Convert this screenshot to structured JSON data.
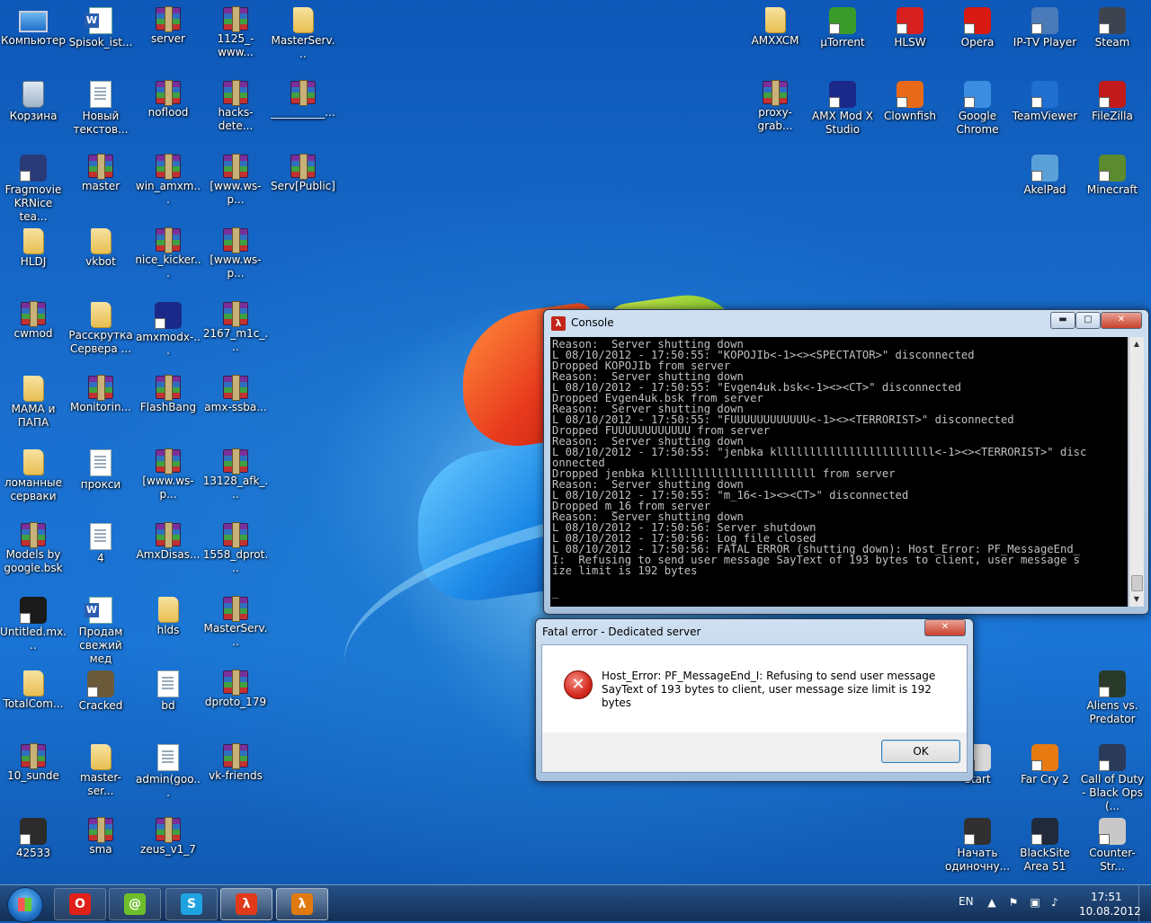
{
  "desktop": {
    "icons_left": [
      {
        "label": "Компьютер",
        "icon": "computer-icon"
      },
      {
        "label": "Spisok_ist...",
        "icon": "word-doc-icon"
      },
      {
        "label": "server",
        "icon": "winrar-icon"
      },
      {
        "label": "1125_-www...",
        "icon": "winrar-icon"
      },
      {
        "label": "MasterServ...",
        "icon": "folder-icon"
      },
      {
        "label": "Корзина",
        "icon": "recycle-bin-icon"
      },
      {
        "label": "Новый текстов...",
        "icon": "text-doc-icon"
      },
      {
        "label": "noflood",
        "icon": "winrar-icon"
      },
      {
        "label": "hacks-dete...",
        "icon": "winrar-icon"
      },
      {
        "label": "__________...",
        "icon": "winrar-icon"
      },
      {
        "label": "Fragmovie KRNice tea...",
        "icon": "flv-icon"
      },
      {
        "label": "master",
        "icon": "winrar-icon"
      },
      {
        "label": "win_amxm...",
        "icon": "winrar-icon"
      },
      {
        "label": "[www.ws-p...",
        "icon": "winrar-icon"
      },
      {
        "label": "Serv[Public]",
        "icon": "winrar-icon"
      },
      {
        "label": "HLDJ",
        "icon": "folder-icon"
      },
      {
        "label": "vkbot",
        "icon": "folder-icon"
      },
      {
        "label": "nice_kicker...",
        "icon": "winrar-icon"
      },
      {
        "label": "[www.ws-p...",
        "icon": "winrar-icon"
      },
      {
        "label": "cwmod",
        "icon": "winrar-icon"
      },
      {
        "label": "Расскрутка Сервера ...",
        "icon": "folder-icon"
      },
      {
        "label": "amxmodx-...",
        "icon": "amxx-icon"
      },
      {
        "label": "2167_m1c_...",
        "icon": "winrar-icon"
      },
      {
        "label": "МАМА и ПАПА",
        "icon": "folder-icon"
      },
      {
        "label": "Monitorin...",
        "icon": "winrar-icon"
      },
      {
        "label": "FlashBang",
        "icon": "winrar-icon"
      },
      {
        "label": "amx-ssba...",
        "icon": "winrar-icon"
      },
      {
        "label": "ломанные серваки",
        "icon": "folder-icon"
      },
      {
        "label": "прокси",
        "icon": "text-doc-icon"
      },
      {
        "label": "[www.ws-p...",
        "icon": "winrar-icon"
      },
      {
        "label": "13128_afk_...",
        "icon": "winrar-icon"
      },
      {
        "label": "Models by google.bsk",
        "icon": "winrar-icon"
      },
      {
        "label": "4",
        "icon": "text-doc-icon"
      },
      {
        "label": "AmxDisas...",
        "icon": "winrar-icon"
      },
      {
        "label": "1558_dprot...",
        "icon": "winrar-icon"
      },
      {
        "label": "Untitled.mx...",
        "icon": "video-icon"
      },
      {
        "label": "Продам свежий мед",
        "icon": "word-doc-icon"
      },
      {
        "label": "hlds",
        "icon": "folder-icon"
      },
      {
        "label": "MasterServ...",
        "icon": "winrar-icon"
      },
      {
        "label": "TotalCom...",
        "icon": "folder-icon"
      },
      {
        "label": "Cracked",
        "icon": "cracked-icon"
      },
      {
        "label": "bd",
        "icon": "notepad-icon"
      },
      {
        "label": "dproto_179",
        "icon": "winrar-icon"
      },
      {
        "label": "10_sunde",
        "icon": "winrar-icon"
      },
      {
        "label": "master-ser...",
        "icon": "folder-icon"
      },
      {
        "label": "admin(goo...",
        "icon": "notepad-icon"
      },
      {
        "label": "vk-friends",
        "icon": "winrar-icon"
      },
      {
        "label": "42533",
        "icon": "image-icon"
      },
      {
        "label": "sma",
        "icon": "winrar-icon"
      },
      {
        "label": "zeus_v1_7",
        "icon": "winrar-icon"
      }
    ],
    "icons_right": [
      {
        "label": "AMXXCM",
        "icon": "folder-icon"
      },
      {
        "label": "µTorrent",
        "icon": "utorrent-icon"
      },
      {
        "label": "HLSW",
        "icon": "hlsw-icon"
      },
      {
        "label": "Opera",
        "icon": "opera-icon"
      },
      {
        "label": "IP-TV Player",
        "icon": "iptv-icon"
      },
      {
        "label": "Steam",
        "icon": "steam-icon"
      },
      {
        "label": "proxy-grab...",
        "icon": "winrar-icon"
      },
      {
        "label": "AMX Mod X Studio",
        "icon": "amxx-studio-icon"
      },
      {
        "label": "Clownfish",
        "icon": "clownfish-icon"
      },
      {
        "label": "Google Chrome",
        "icon": "chrome-icon"
      },
      {
        "label": "TeamViewer",
        "icon": "teamviewer-icon"
      },
      {
        "label": "FileZilla",
        "icon": "filezilla-icon"
      },
      {
        "label": "AkelPad",
        "icon": "akelpad-icon"
      },
      {
        "label": "Minecraft",
        "icon": "minecraft-icon"
      },
      {
        "label": "Aliens vs. Predator",
        "icon": "avp-icon"
      },
      {
        "label": "Start",
        "icon": "start-app-icon"
      },
      {
        "label": "Far Cry 2",
        "icon": "farcry-icon"
      },
      {
        "label": "Call of Duty - Black Ops (...",
        "icon": "cod-icon"
      },
      {
        "label": "Начать одиночну...",
        "icon": "game-star-icon"
      },
      {
        "label": "BlackSite Area 51",
        "icon": "blacksite-icon"
      },
      {
        "label": "Counter-Str...",
        "icon": "cs-icon"
      }
    ]
  },
  "console": {
    "title": "Console",
    "text": "Reason:  Server shutting down\nL 08/10/2012 - 17:50:55: \"KOPOJIb<-1><><SPECTATOR>\" disconnected\nDropped KOPOJIb from server\nReason:  Server shutting down\nL 08/10/2012 - 17:50:55: \"Evgen4uk.bsk<-1><><CT>\" disconnected\nDropped Evgen4uk.bsk from server\nReason:  Server shutting down\nL 08/10/2012 - 17:50:55: \"FUUUUUUUUUUUU<-1><><TERRORIST>\" disconnected\nDropped FUUUUUUUUUUUU from server\nReason:  Server shutting down\nL 08/10/2012 - 17:50:55: \"jenbka kllllllllllllllllllllllll<-1><><TERRORIST>\" disc\nonnected\nDropped jenbka kllllllllllllllllllllllll from server\nReason:  Server shutting down\nL 08/10/2012 - 17:50:55: \"m_16<-1><><CT>\" disconnected\nDropped m_16 from server\nReason:  Server shutting down\nL 08/10/2012 - 17:50:56: Server shutdown\nL 08/10/2012 - 17:50:56: Log file closed\nL 08/10/2012 - 17:50:56: FATAL ERROR (shutting down): Host_Error: PF_MessageEnd_\nI:  Refusing to send user message SayText of 193 bytes to client, user message s\nize limit is 192 bytes\n\n_",
    "controls": {
      "minimize": "▬",
      "maximize": "□",
      "close": "✕"
    }
  },
  "dialog": {
    "title": "Fatal error - Dedicated server",
    "message": "Host_Error: PF_MessageEnd_I:  Refusing to send user message SayText of 193 bytes to client, user message size limit is 192 bytes",
    "ok_label": "OK",
    "close": "✕"
  },
  "taskbar": {
    "apps": [
      {
        "name": "Opera",
        "glyph": "O",
        "color": "#e0201a"
      },
      {
        "name": "ICQ",
        "glyph": "@",
        "color": "#6fbf2a"
      },
      {
        "name": "Skype",
        "glyph": "S",
        "color": "#1fa3e0"
      },
      {
        "name": "Half-Life",
        "glyph": "λ",
        "color": "#e03a1a"
      },
      {
        "name": "Half-Life",
        "glyph": "λ",
        "color": "#e07a10"
      }
    ],
    "language": "EN",
    "time": "17:51",
    "date": "10.08.2012"
  }
}
